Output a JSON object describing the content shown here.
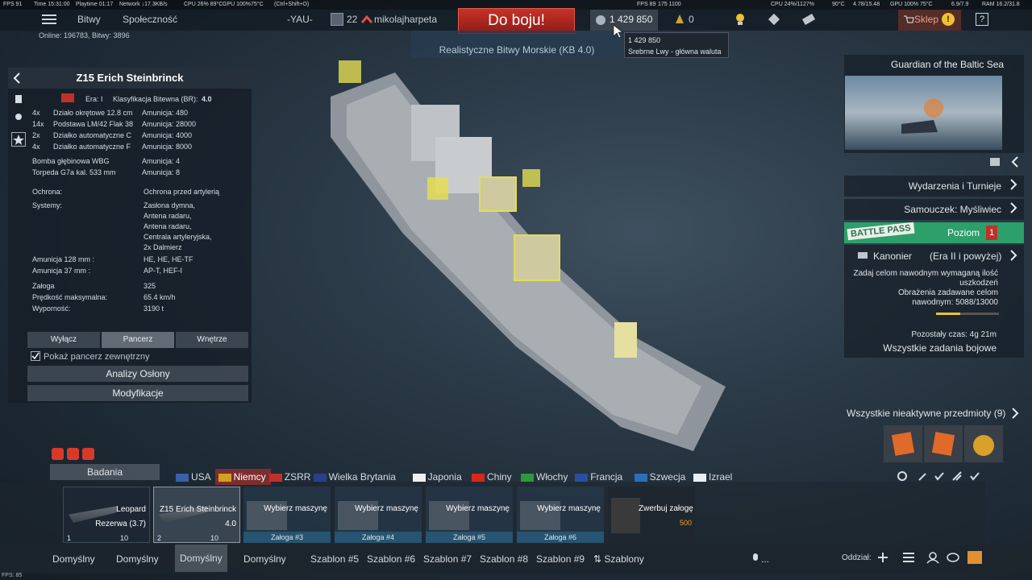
{
  "overlay": {
    "fps": "FPS 91",
    "time": "Time 15:31:00",
    "playtime": "Playtime 01:17",
    "network": "Network ↓17.3KB/s",
    "cpu": "CPU 26% 89°C",
    "gpu": "GPU 100%75°C",
    "shortcut": "(Ctrl+Shift+O)",
    "fps2": "FPS 89",
    "frames": "175 1100",
    "cpu2": "CPU 24%/1127%",
    "temp": "90°C",
    "net2": "4.78/15.48",
    "gpu2": "GPU 100% 75°C",
    "mem": "6.9/7.9",
    "ram": "RAM 16.2/31.8",
    "fps_bottom": "FPS: 85"
  },
  "topbar": {
    "battles": "Bitwy",
    "community": "Społeczność",
    "squad": "-YAU-",
    "level": "22",
    "player": "mikolajharpeta",
    "battle_btn": "Do boju!",
    "mode": "Realistyczne Bitwy Morskie (KB 4.0)",
    "silver": "1 429 850",
    "gold": "0",
    "shop": "Sklep"
  },
  "online": "Online: 196783, Bitwy: 3896",
  "tooltip": {
    "value": "1 429 850",
    "desc": "Srebrne Lwy - główna waluta"
  },
  "panel": {
    "title": "Z15 Erich Steinbrinck",
    "era": "Era: I",
    "br_label": "Klasyfikacja Bitewna (BR):",
    "br": "4.0",
    "weapons": [
      {
        "n": "4x",
        "name": "Działo okrętowe 12.8 cm",
        "ammo": "Amunicja:  480"
      },
      {
        "n": "14x",
        "name": "Podstawa LM/42 Flak 38",
        "ammo": "Amunicja:  28000"
      },
      {
        "n": "2x",
        "name": "Działko automatyczne C",
        "ammo": "Amunicja:  4000"
      },
      {
        "n": "4x",
        "name": "Działko automatyczne F",
        "ammo": "Amunicja:  8000"
      }
    ],
    "bombs": [
      {
        "name": "Bomba głębinowa WBG",
        "ammo": "Amunicja:  4"
      },
      {
        "name": "Torpeda G7a kal. 533 mm",
        "ammo": "Amunicja:  8"
      }
    ],
    "protection_l": "Ochrona:",
    "protection_v": "Ochrona przed artylerią",
    "systems_l": "Systemy:",
    "systems": [
      "Zasłona dymna,",
      "Antena radaru,",
      "Antena radaru,",
      "Centrala artyleryjska,",
      "2x Dalmierz"
    ],
    "ammo128_l": "Amunicja 128 mm :",
    "ammo128_v": "HE, HE, HE-TF",
    "ammo37_l": "Amunicja 37 mm :",
    "ammo37_v": "AP-T, HEF-I",
    "crew_l": "Załoga",
    "crew_v": "325",
    "speed_l": "Prędkość maksymalna:",
    "speed_v": "65.4 km/h",
    "disp_l": "Wyporność:",
    "disp_v": "3190 t",
    "tab1": "Wyłącz",
    "tab2": "Pancerz",
    "tab3": "Wnętrze",
    "check": "Pokaż pancerz zewnętrzny",
    "btn1": "Analizy Osłony",
    "btn2": "Modyfikacje"
  },
  "right": {
    "event": "Guardian of the Baltic Sea",
    "events": "Wydarzenia i Turnieje",
    "tutorial": "Samouczek: Myśliwiec",
    "bp": "BATTLE PASS",
    "bp_level": "Poziom",
    "bp_num": "1",
    "task": "Kanonier",
    "task_era": "(Era II i powyżej)",
    "task_desc": [
      "Zadaj celom nawodnym wymaganą ilość",
      "uszkodzeń",
      "Obrażenia zadawane celom",
      "nawodnym: 5088/13000"
    ],
    "time_left": "Pozostały czas: 4g 21m",
    "all_tasks": "Wszystkie zadania bojowe",
    "inactive": "Wszystkie nieaktywne przedmioty (9)",
    "progress": 0.39
  },
  "research": "Badania",
  "nations": [
    "USA",
    "Niemcy",
    "ZSRR",
    "Wielka Brytania",
    "Japonia",
    "Chiny",
    "Włochy",
    "Francja",
    "Szwecja",
    "Izrael"
  ],
  "slots": [
    {
      "name": "Leopard",
      "sub": "Rezerwa (3.7)",
      "crew": "1",
      "cost": "10"
    },
    {
      "name": "Z15 Erich Steinbrinck",
      "sub": "4.0",
      "crew": "2",
      "cost": "10"
    }
  ],
  "crews": [
    {
      "label": "Wybierz maszynę",
      "sub": "Załoga #3"
    },
    {
      "label": "Wybierz maszynę",
      "sub": "Załoga #4"
    },
    {
      "label": "Wybierz maszynę",
      "sub": "Załoga #5"
    },
    {
      "label": "Wybierz maszynę",
      "sub": "Załoga #6"
    }
  ],
  "hire": {
    "label": "Zwerbuj załogę",
    "cost": "500"
  },
  "bottom": {
    "tabs": [
      "Domyślny",
      "Domyślny",
      "Domyślny",
      "Domyślny",
      "Szablon #5",
      "Szablon #6",
      "Szablon #7",
      "Szablon #8",
      "Szablon #9"
    ],
    "templates": "Szablony",
    "squad": "Oddział:",
    "voice": "..."
  },
  "colors": {
    "accent": "#b02a23",
    "gold": "#f0c030",
    "bp": "#2c9f6a"
  }
}
